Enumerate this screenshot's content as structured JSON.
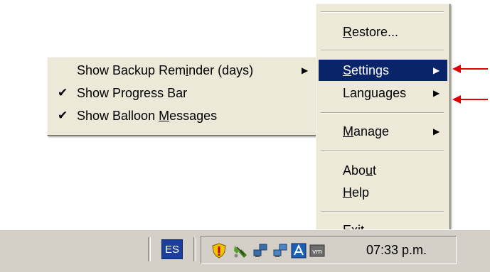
{
  "main_menu": {
    "items": [
      {
        "label": "Restore...",
        "mnemonic": "R",
        "rest": "estore..."
      },
      {
        "label": "Settings",
        "mnemonic": "S",
        "rest": "ettings",
        "has_submenu": true,
        "highlighted": true
      },
      {
        "label": "Languages",
        "mnemonic": "",
        "rest": "Languages",
        "has_submenu": true
      },
      {
        "label": "Manage",
        "mnemonic": "M",
        "rest": "anage",
        "has_submenu": true
      },
      {
        "label": "About",
        "pre": "Abo",
        "mnemonic": "u",
        "rest": "t"
      },
      {
        "label": "Help",
        "mnemonic": "H",
        "rest": "elp"
      },
      {
        "label": "Exit",
        "pre": "E",
        "mnemonic": "x",
        "rest": "it"
      }
    ]
  },
  "settings_submenu": {
    "items": [
      {
        "label": "Show Backup Reminder (days)",
        "pre": "Show Backup Rem",
        "mnemonic": "i",
        "rest": "nder (days)",
        "checked": false,
        "has_submenu": true
      },
      {
        "label": "Show Progress Bar",
        "pre": "Show Pro",
        "mnemonic": "g",
        "rest": "ress Bar",
        "checked": true
      },
      {
        "label": "Show Balloon Messages",
        "pre": "Show Balloon ",
        "mnemonic": "M",
        "rest": "essages",
        "checked": true
      }
    ]
  },
  "taskbar": {
    "language_indicator": "ES",
    "clock": "07:33 p.m.",
    "tray_icons": [
      "security-shield-icon",
      "network-plug-icon",
      "network-computers-icon",
      "network-computers-icon",
      "app-blue-icon",
      "vmware-icon"
    ]
  },
  "colors": {
    "menu_bg": "#ece9d8",
    "highlight": "#0a246a",
    "annotation_arrow": "#e00000",
    "taskbar_bg": "#d4d0c8"
  }
}
